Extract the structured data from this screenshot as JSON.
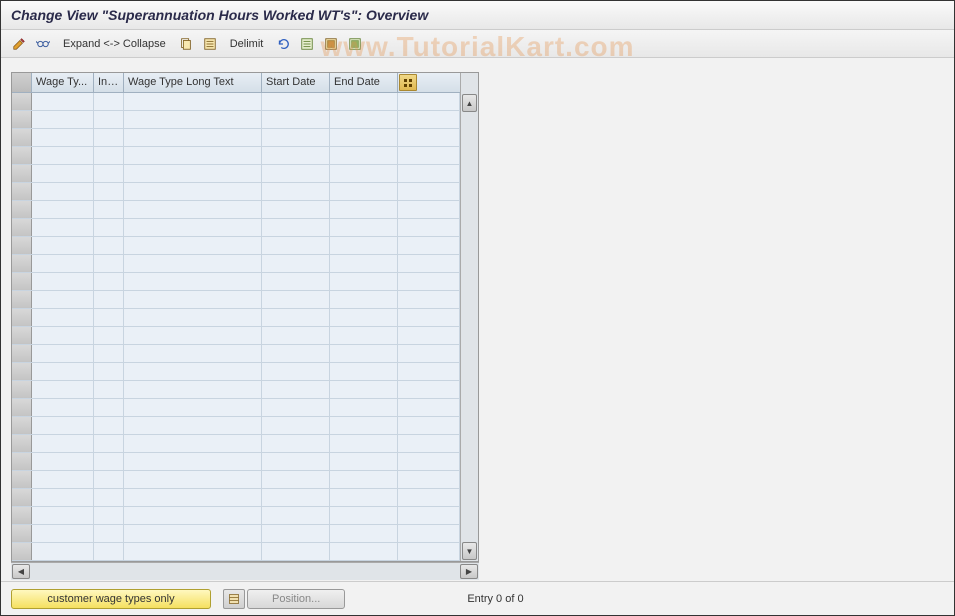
{
  "title": "Change View \"Superannuation Hours Worked WT's\": Overview",
  "watermark": "www.TutorialKart.com",
  "toolbar": {
    "expand_collapse_label": "Expand <-> Collapse",
    "delimit_label": "Delimit"
  },
  "table": {
    "columns": [
      "Wage Ty...",
      "Inf...",
      "Wage Type Long Text",
      "Start Date",
      "End Date"
    ],
    "row_count": 26,
    "rows": []
  },
  "footer": {
    "customer_btn": "customer wage types only",
    "position_btn": "Position...",
    "entry_text": "Entry 0 of 0"
  },
  "icons": {
    "pencil": "pencil",
    "glasses": "glasses",
    "copy": "copy",
    "select_all": "select-all",
    "undo": "undo",
    "save_variant": "save-variant",
    "transport": "transport",
    "table_settings": "table-settings"
  }
}
